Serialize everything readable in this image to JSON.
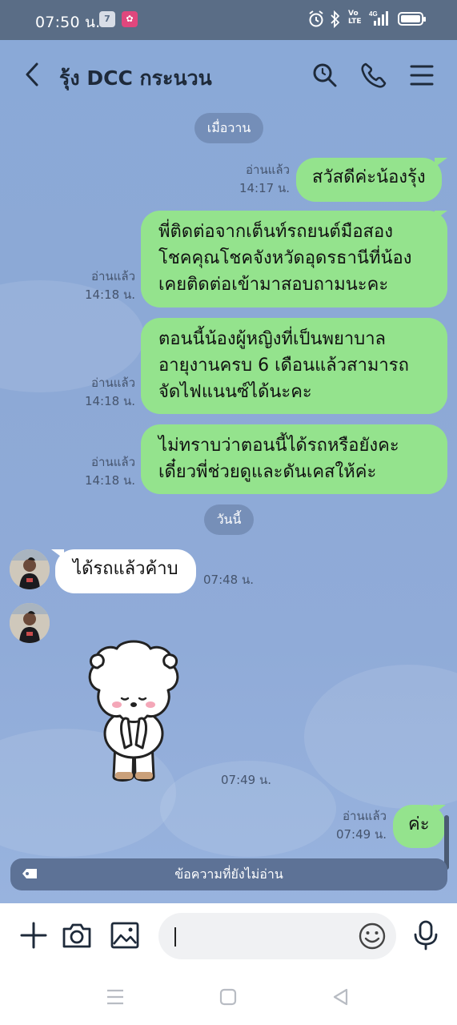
{
  "status_bar": {
    "time": "07:50 น.",
    "network": "4G",
    "volte": "Vo LTE"
  },
  "header": {
    "title": "รุ้ง  DCC กระนวน"
  },
  "chat": {
    "date_yesterday": "เมื่อวาน",
    "date_today": "วันนี้",
    "messages": [
      {
        "direction": "out",
        "read": "อ่านแล้ว",
        "time": "14:17 น.",
        "lines": [
          "สวัสดีค่ะน้องรุ้ง"
        ]
      },
      {
        "direction": "out",
        "read": "อ่านแล้ว",
        "time": "14:18 น.",
        "lines": [
          "พี่ติดต่อจากเต็นท์รถยนต์มือสอง",
          "โชคคุณโชคจังหวัดอุดรธานีที่น้อง",
          "เคยติดต่อเข้ามาสอบถามนะคะ"
        ]
      },
      {
        "direction": "out",
        "read": "อ่านแล้ว",
        "time": "14:18 น.",
        "lines": [
          "ตอนนี้น้องผู้หญิงที่เป็นพยาบาล",
          "อายุงานครบ 6 เดือนแล้วสามารถ",
          "จัดไฟแนนซ์ได้นะคะ"
        ]
      },
      {
        "direction": "out",
        "read": "อ่านแล้ว",
        "time": "14:18 น.",
        "lines": [
          "ไม่ทราบว่าตอนนี้ได้รถหรือยังคะ",
          "เดี๋ยวพี่ช่วยดูและดันเคสให้ค่ะ"
        ]
      },
      {
        "direction": "in",
        "time": "07:48 น.",
        "lines": [
          "ได้รถแล้วค้าบ"
        ]
      },
      {
        "direction": "in",
        "type": "sticker",
        "time": "07:49 น."
      },
      {
        "direction": "out",
        "read": "อ่านแล้ว",
        "time": "07:49 น.",
        "lines": [
          "ค่ะ"
        ]
      }
    ],
    "unread_label": "ข้อความที่ยังไม่อ่าน"
  },
  "input": {
    "placeholder": "",
    "value": ""
  },
  "icons": {
    "back": "back-arrow-icon",
    "search": "search-icon",
    "call": "phone-icon",
    "menu": "menu-icon",
    "plus": "plus-icon",
    "camera": "camera-icon",
    "gallery": "image-icon",
    "emoji": "emoji-icon",
    "mic": "microphone-icon"
  },
  "colors": {
    "outgoing_bubble": "#94e38d",
    "incoming_bubble": "#ffffff",
    "chat_background": "#8aa9d7",
    "status_bar": "#5a6d86"
  }
}
